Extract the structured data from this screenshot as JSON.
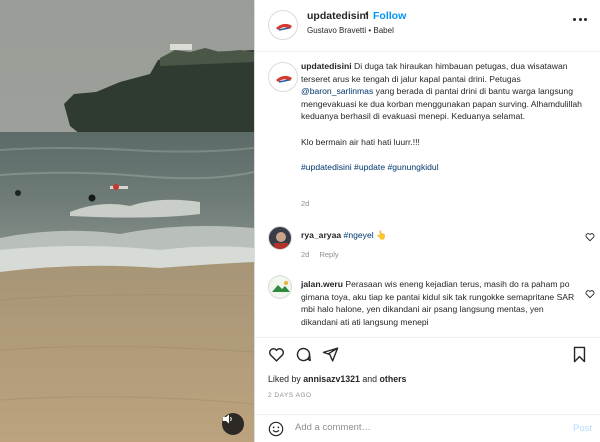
{
  "post": {
    "username": "updatedisini",
    "dot": "•",
    "follow_label": "Follow",
    "audio_line": "Gustavo Bravetti • Babel"
  },
  "caption": {
    "username": "updatedisini",
    "text_1": "Di duga tak hiraukan himbauan petugas, dua wisatawan terseret arus ke tengah di jalur kapal pantai drini. Petugas ",
    "mention": "@baron_sarlinmas",
    "text_2": " yang berada di pantai drini di bantu warga langsung mengevakuasi ke dua korban menggunakan papan surving. Alhamdulillah keduanya berhasil di evakuasi menepi. Keduanya selamat.",
    "line2": "Klo bermain air hati hati luurr.!!!",
    "hashtags": "#updatedisini #update #gunungkidul",
    "time": "2d"
  },
  "comments": [
    {
      "username": "rya_aryaa",
      "text": "#ngeyel 👆",
      "time": "2d",
      "reply_label": "Reply"
    },
    {
      "username": "jalan.weru",
      "text": "Perasaan wis eneng kejadian terus, masih do ra paham po gimana toya, aku tiap ke pantai kidul sik tak rungokke semapritane SAR mbi halo halone, yen dikandani air psang langsung mentas, yen dikandani ati ati langsung menepi"
    }
  ],
  "likes": {
    "prefix": "Liked by ",
    "user": "annisazv1321",
    "and": " and ",
    "others": "others"
  },
  "date": "2 DAYS AGO",
  "add_comment": {
    "placeholder": "Add a comment…",
    "post_label": "Post"
  },
  "icons": {
    "more": "more-horizontal-icon",
    "like": "heart-icon",
    "comment": "comment-icon",
    "share": "share-icon",
    "save": "bookmark-icon",
    "emoji": "emoji-icon",
    "audio": "speaker-icon"
  },
  "colors": {
    "follow": "#0095f6",
    "link": "#00376b",
    "muted": "#8e8e8e",
    "post_disabled": "#b3dbff"
  }
}
